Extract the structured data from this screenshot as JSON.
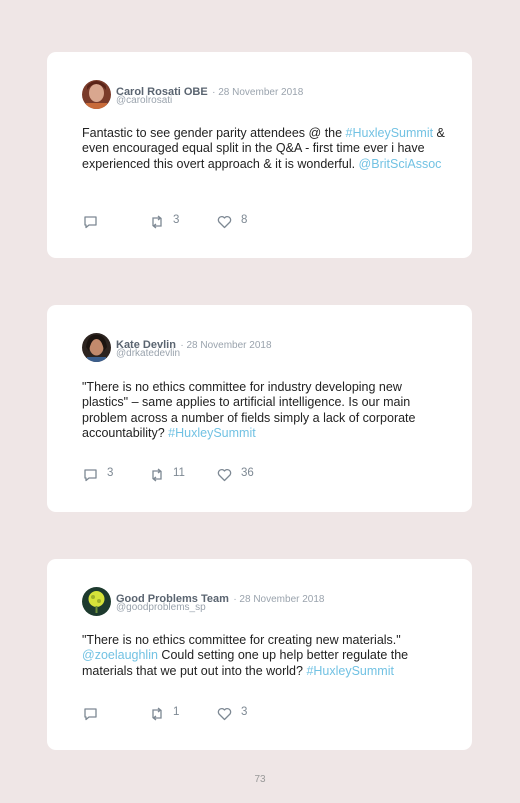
{
  "tweets": [
    {
      "name": "Carol Rosati OBE",
      "date": "· 28 November 2018",
      "handle": "@carolrosati",
      "text": [
        {
          "t": "Fantastic to see gender parity attendees @ the ",
          "link": false
        },
        {
          "t": "#HuxleySummit",
          "link": true
        },
        {
          "t": " & even encouraged equal split in the Q&A - first time ever i have experienced this overt approach & it is wonderful. ",
          "link": false
        },
        {
          "t": "@BritSciAssoc",
          "link": true
        }
      ],
      "replies": "",
      "retweets": "3",
      "likes": "8"
    },
    {
      "name": "Kate Devlin",
      "date": "· 28 November 2018",
      "handle": "@drkatedevlin",
      "text": [
        {
          "t": "\"There is no ethics committee for industry developing new plastics\" – same applies to artificial intelligence. Is our main problem across a number of fields simply a lack of corporate accountability? ",
          "link": false
        },
        {
          "t": "#HuxleySummit",
          "link": true
        }
      ],
      "replies": "3",
      "retweets": "11",
      "likes": "36"
    },
    {
      "name": "Good Problems Team",
      "date": "· 28 November 2018",
      "handle": "@goodproblems_sp",
      "text": [
        {
          "t": "\"There is no ethics committee for creating new materials.\" ",
          "link": false
        },
        {
          "t": "@zoelaughlin",
          "link": true
        },
        {
          "t": " Could setting one up help better regulate the materials that we put out into the world? ",
          "link": false
        },
        {
          "t": "#HuxleySummit",
          "link": true
        }
      ],
      "replies": "",
      "retweets": "1",
      "likes": "3"
    }
  ],
  "page_number": "73",
  "colors": {
    "background": "#efe6e6",
    "link": "#72c2e3",
    "name": "#5a6470",
    "meta": "#9aa3ad"
  }
}
